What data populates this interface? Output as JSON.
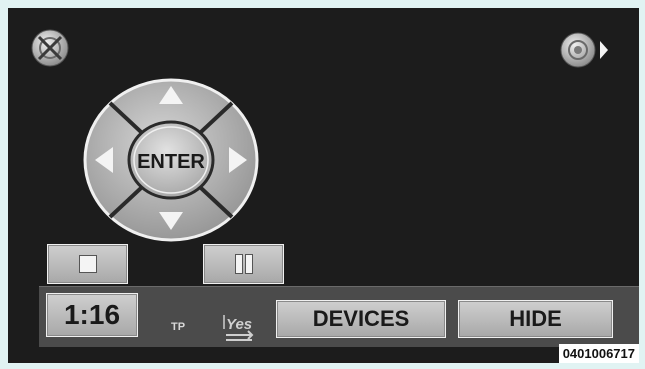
{
  "player": {
    "clock": "1:16",
    "tp_label": "TP",
    "enter_label": "ENTER",
    "devices_label": "DEVICES",
    "hide_label": "HIDE"
  },
  "icons": {
    "top_left": "close-icon",
    "top_right": "audio-source-icon",
    "tp_status": "traffic-program-icon"
  },
  "image_code": "0401006717",
  "colors": {
    "screen_bg": "#1c1c1c",
    "button_face": "#bcbcbc",
    "bottom_bar": "#4b4b4b",
    "page_bg": "#e1f3f3"
  }
}
